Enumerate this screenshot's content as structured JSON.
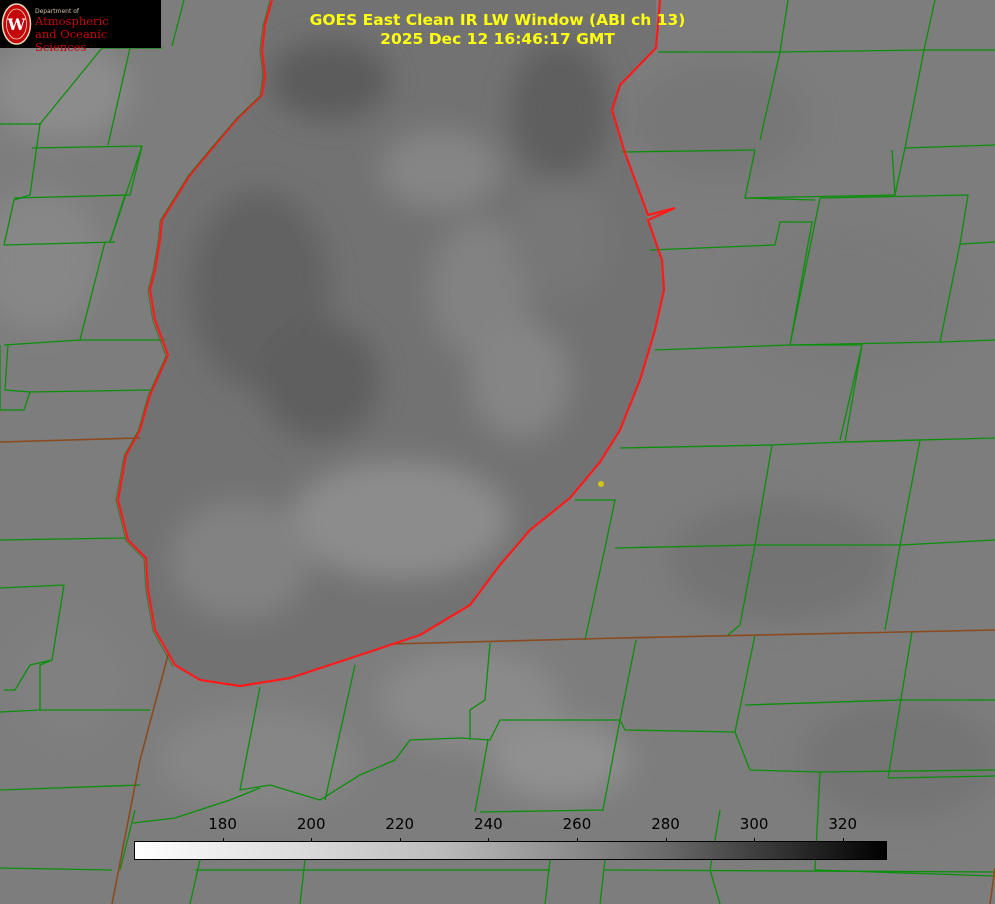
{
  "header": {
    "logo": {
      "dept_text": "Department of",
      "line1": "Atmospheric",
      "line2": "and Oceanic Sciences",
      "seal_letter": "W"
    },
    "title_line1": "GOES East Clean IR LW Window (ABI ch 13)",
    "title_line2": "2025 Dec 12 16:46:17 GMT"
  },
  "colorbar": {
    "min": 160,
    "max": 330,
    "ticks": [
      {
        "value": 180,
        "label": "180"
      },
      {
        "value": 200,
        "label": "200"
      },
      {
        "value": 220,
        "label": "220"
      },
      {
        "value": 240,
        "label": "240"
      },
      {
        "value": 260,
        "label": "260"
      },
      {
        "value": 280,
        "label": "280"
      },
      {
        "value": 300,
        "label": "300"
      },
      {
        "value": 320,
        "label": "320"
      }
    ]
  },
  "colors": {
    "title": "#ffff10",
    "shoreline": "#ff1a1a",
    "county_lines": "#0a8f0a",
    "state_lines": "#8b4a1e",
    "marker": "#d4c41a"
  }
}
